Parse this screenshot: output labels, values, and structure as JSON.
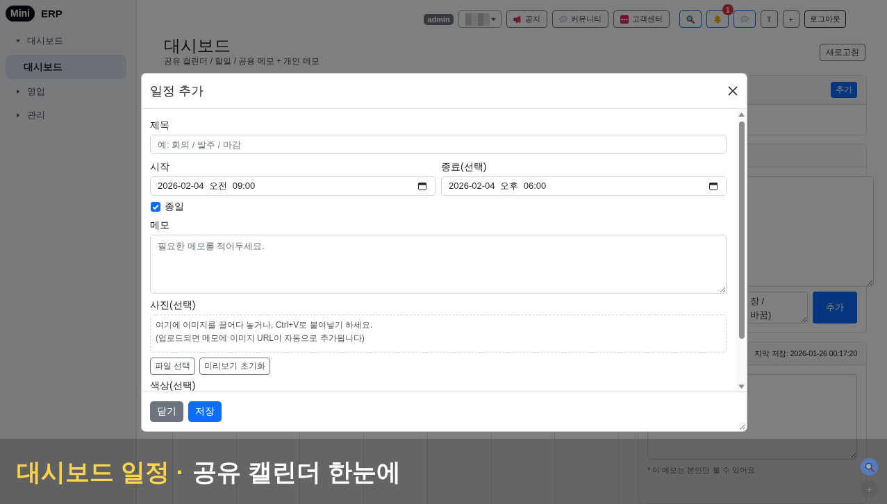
{
  "sidebar": {
    "logo": {
      "badge": "Mini",
      "text": "ERP"
    },
    "items": [
      {
        "label": "대시보드",
        "expanded": true,
        "selected": false,
        "children": [
          {
            "label": "대시보드",
            "selected": true
          }
        ]
      },
      {
        "label": "영업",
        "expanded": false,
        "selected": false
      },
      {
        "label": "관리",
        "expanded": false,
        "selected": false
      }
    ]
  },
  "topbar": {
    "user_badge": "admin",
    "links": [
      {
        "label": "공지"
      },
      {
        "label": "커뮤니티"
      },
      {
        "label": "고객센터"
      }
    ],
    "tools": [
      {
        "kind": "icon"
      },
      {
        "kind": "icon",
        "badge": "1"
      },
      {
        "kind": "icon"
      },
      {
        "kind": "text",
        "label": "T"
      },
      {
        "kind": "text",
        "label": "+"
      }
    ],
    "logout": "로그아웃"
  },
  "page_header": {
    "title": "대시보드",
    "subtitle": "공유 캘린더 / 할일 / 공용 메모 + 개인 메모",
    "refresh_button": "새로고침"
  },
  "right_column": {
    "card_1": {
      "button": "추가"
    },
    "card_2": {
      "input_placeholder": "장 /\n바꿈)",
      "button": "추가"
    },
    "card_3": {
      "header_text": "지막 저장: 2026-01-26 00:17:20",
      "note": "* 이 메모는 본인만 볼 수 있어요."
    }
  },
  "floating_buttons": [
    {
      "kind": "icon"
    },
    {
      "kind": "text",
      "label": "+"
    }
  ],
  "modal": {
    "title": "일정 추가",
    "title_field": {
      "label": "제목",
      "placeholder": "예: 회의 / 발주 / 마감"
    },
    "start_field": {
      "label": "시작",
      "value": "2026-02-04 오전 09:00"
    },
    "end_field": {
      "label": "종료(선택)",
      "value": "2026-02-04 오후 06:00"
    },
    "all_day": {
      "label": "종일",
      "checked": true
    },
    "memo_field": {
      "label": "메모",
      "placeholder": "필요한 메모를 적어두세요."
    },
    "photo_field": {
      "label": "사진(선택)",
      "hint_lines": [
        "여기에 이미지를 끌어다 놓거나, Ctrl+V로 붙여넣기 하세요.",
        "(업로드되면 메모에 이미지 URL이 자동으로 추가됩니다)"
      ],
      "buttons": [
        "파일 선택",
        "미리보기 초기화"
      ]
    },
    "color_field": {
      "label": "색상(선택)"
    },
    "footer_buttons": [
      {
        "kind": "secondary",
        "label": "닫기"
      },
      {
        "kind": "primary",
        "label": "저장"
      }
    ]
  },
  "caption": {
    "highlight": "대시보드 일정 ·",
    "text": "공유 캘린더 한눈에"
  }
}
